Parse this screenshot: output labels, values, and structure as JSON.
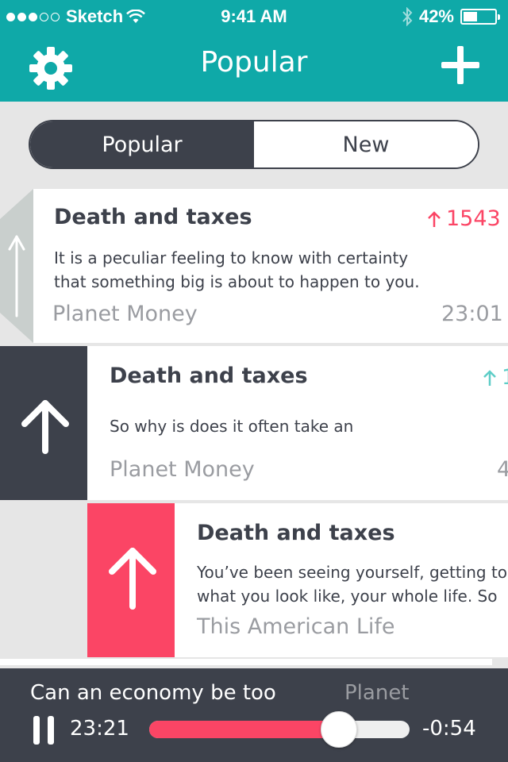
{
  "status_bar": {
    "carrier": "Sketch",
    "time": "9:41 AM",
    "battery": "42%",
    "battery_level": 0.42,
    "signal_bars": 3
  },
  "nav": {
    "title": "Popular",
    "left_icon": "gear-icon",
    "right_icon": "plus-icon"
  },
  "segments": {
    "popular_label": "Popular",
    "new_label": "New",
    "selected": "Popular"
  },
  "cards": [
    {
      "title": "Death and taxes",
      "votes": "1543",
      "body_line1": "It is a peculiar feeling to know with certainty",
      "body_line2": "that something big is about to happen to you.",
      "source": "Planet Money",
      "duration": "23:01",
      "vote_color": "#fb4565"
    },
    {
      "title": "Death and taxes",
      "votes": "1",
      "body_line1": "So why is does it often take an",
      "source": "Planet Money",
      "duration": "4",
      "vote_color": "#5ecdc7"
    },
    {
      "title": "Death and taxes",
      "body_line1": "You’ve been seeing yourself, getting to",
      "body_line2": "what you look like, your whole life. So",
      "source": "This American Life"
    }
  ],
  "player": {
    "title": "Can an economy be too",
    "source": "Planet",
    "elapsed": "23:21",
    "remaining": "-0:54",
    "progress": 0.73
  },
  "colors": {
    "teal": "#0fa9a8",
    "dark": "#3d414b",
    "pink": "#fb4565"
  }
}
